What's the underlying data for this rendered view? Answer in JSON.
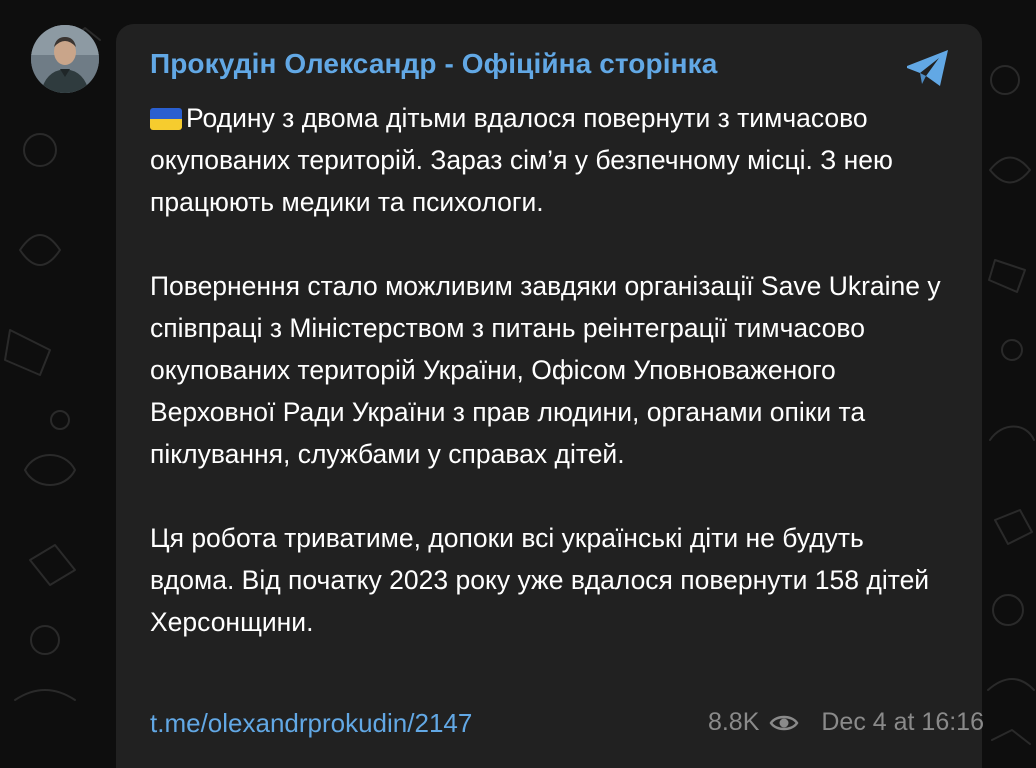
{
  "channel": {
    "name": "Прокудін Олександр - Офіційна сторінка",
    "avatar_icon": "person-avatar"
  },
  "post": {
    "flag_icon": "ukraine-flag-icon",
    "paragraphs": [
      "Родину з двома дітьми вдалося повернути з тимчасово окупованих територій. Зараз сім’я у безпечному місці. З нею працюють медики та психологи.",
      "Повернення стало можливим завдяки організації Save Ukraine у співпраці з Міністерством з питань реінтеграції тимчасово окупованих територій України, Офісом Уповноваженого Верховної Ради України з прав людини, органами опіки та піклування, службами у справах дітей.",
      "Ця робота триватиме, допоки всі українські діти не будуть вдома. Від початку 2023 року уже вдалося повернути 158 дітей Херсонщини."
    ],
    "link": "t.me/olexandrprokudin/2147",
    "views": "8.8K",
    "views_icon": "eye-icon",
    "timestamp": "Dec 4 at 16:16"
  },
  "share_icon": "telegram-send-icon",
  "colors": {
    "background": "#0e0e0e",
    "bubble": "#212121",
    "accent": "#62a8e5",
    "text": "#ffffff",
    "meta": "#8a8a8a",
    "flag_blue": "#2a5fd0",
    "flag_yellow": "#f6cc2e"
  }
}
